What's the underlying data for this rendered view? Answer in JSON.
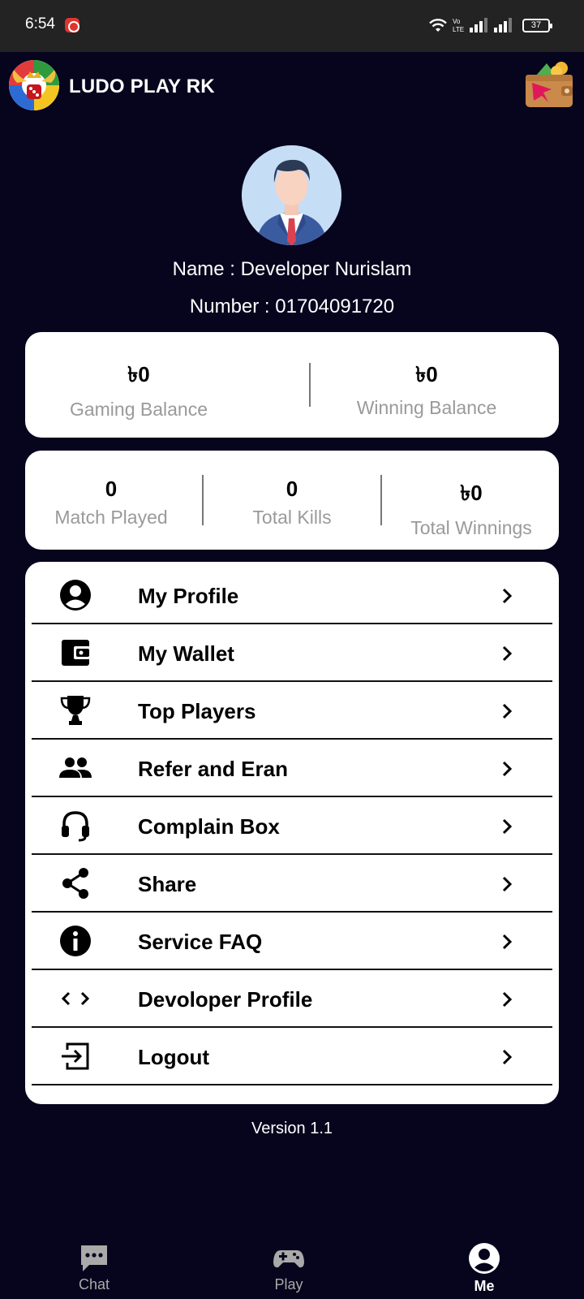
{
  "status_bar": {
    "time": "6:54",
    "battery": "37"
  },
  "header": {
    "app_title": "LUDO PLAY RK"
  },
  "profile": {
    "name_line": "Name : Developer Nurislam",
    "number_line": "Number : 01704091720"
  },
  "balances": [
    {
      "value": "৳0",
      "label": "Gaming Balance"
    },
    {
      "value": "৳0",
      "label": "Winning Balance"
    }
  ],
  "stats": [
    {
      "value": "0",
      "label": "Match Played"
    },
    {
      "value": "0",
      "label": "Total Kills"
    },
    {
      "value": "৳0",
      "label": "Total Winnings"
    }
  ],
  "menu": [
    {
      "label": "My Profile",
      "icon": "account-circle-icon"
    },
    {
      "label": "My Wallet",
      "icon": "wallet-icon"
    },
    {
      "label": "Top Players",
      "icon": "trophy-icon"
    },
    {
      "label": "Refer and Eran",
      "icon": "people-icon"
    },
    {
      "label": "Complain Box",
      "icon": "headset-icon"
    },
    {
      "label": "Share",
      "icon": "share-icon"
    },
    {
      "label": "Service FAQ",
      "icon": "info-icon"
    },
    {
      "label": "Devoloper Profile",
      "icon": "code-icon"
    },
    {
      "label": "Logout",
      "icon": "logout-icon"
    }
  ],
  "version": "Version 1.1",
  "bottom_nav": [
    {
      "label": "Chat",
      "icon": "chat-icon",
      "active": false
    },
    {
      "label": "Play",
      "icon": "gamepad-icon",
      "active": false
    },
    {
      "label": "Me",
      "icon": "account-circle-icon",
      "active": true
    }
  ],
  "colors": {
    "background": "#07041d",
    "status_bar": "#232323",
    "card": "#ffffff",
    "muted_text": "#9a9a9a",
    "inactive_nav": "#a9a9a9"
  }
}
